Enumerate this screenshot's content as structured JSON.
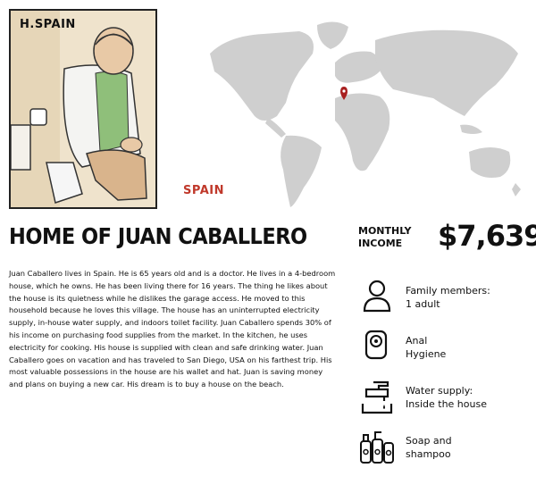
{
  "illustration": {
    "label": "H.SPAIN"
  },
  "map": {
    "marker_color": "#a82020",
    "land_color": "#cfcfcf"
  },
  "country": "SPAIN",
  "home_title": "HOME OF JUAN CABALLERO",
  "income": {
    "label_line1": "MONTHLY",
    "label_line2": "INCOME",
    "value": "$7,639"
  },
  "description": "Juan Caballero lives in Spain. He is 65 years old and is a doctor. He lives in a 4-bedroom house, which he owns. He has been living there for 16 years. The thing he likes about the house is its quietness while he dislikes the garage access. He moved to this household because he loves this village. The house has an uninterrupted electricity supply, in-house water supply, and indoors toilet facility. Juan Caballero spends 30% of his income on purchasing food supplies from the market. In the kitchen, he uses electricity for cooking. His house is supplied with clean and safe drinking water. Juan Caballero goes on vacation and has traveled to San Diego, USA on his farthest trip. His most valuable possessions in the house are his wallet and hat. Juan is saving money and plans on buying a new car. His dream is to buy a house on the beach.",
  "facts": [
    {
      "icon": "person-icon",
      "line1": "Family members:",
      "line2": "1 adult"
    },
    {
      "icon": "toilet-paper-icon",
      "line1": "Anal",
      "line2": "Hygiene"
    },
    {
      "icon": "faucet-icon",
      "line1": "Water supply:",
      "line2": "Inside the house"
    },
    {
      "icon": "soap-bottles-icon",
      "line1": "Soap and",
      "line2": "shampoo"
    }
  ]
}
